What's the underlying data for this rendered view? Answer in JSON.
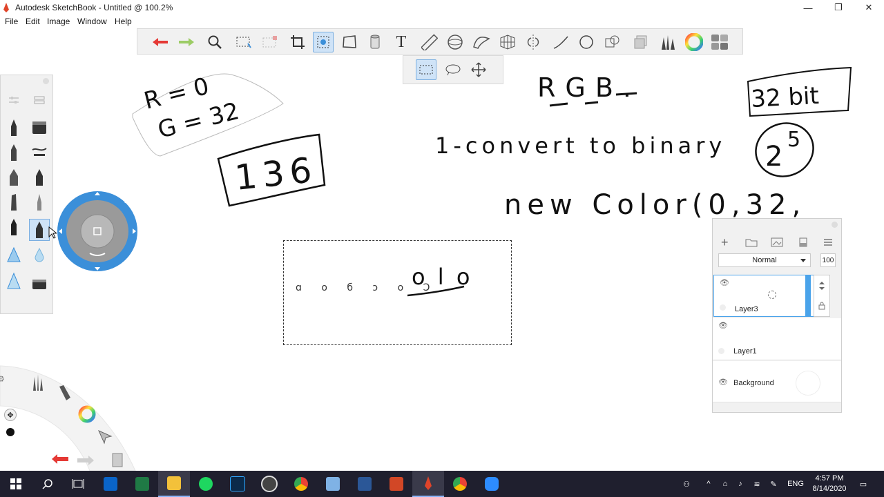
{
  "window": {
    "title": "Autodesk SketchBook - Untitled @ 100.2%",
    "minimize_glyph": "—",
    "maximize_glyph": "❐",
    "close_glyph": "✕"
  },
  "menu": [
    "File",
    "Edit",
    "Image",
    "Window",
    "Help"
  ],
  "toolbar": {
    "tools": [
      "undo-icon",
      "redo-icon",
      "zoom-icon",
      "select-rect-icon",
      "select-lasso-icon",
      "crop-icon",
      "transform-icon",
      "distort-icon",
      "fill-icon",
      "text-icon",
      "ruler-icon",
      "ellipse-guide-icon",
      "french-curve-icon",
      "perspective-icon",
      "symmetry-icon",
      "stroke-icon",
      "shape-icon",
      "copy-paste-icon",
      "layers-icon",
      "brushes-icon",
      "color-wheel-icon",
      "palette-icon"
    ],
    "active_tool": "transform-icon",
    "text_tool_glyph": "T"
  },
  "subtools": [
    "rectangle-select-icon",
    "lasso-select-icon",
    "move-icon"
  ],
  "canvas_text": {
    "r_eq": "R = 0",
    "g_eq": "G = 32",
    "boxed_136": "136",
    "rgb": "RGB.",
    "step1": "1-convert to binary",
    "newcolor": "new Color(0,32,",
    "bit32": "32 bit",
    "two": "2",
    "five": "5",
    "binary_small": "ɑ o  б  ͻ o Ͻ",
    "binary_big": "o l o"
  },
  "layers": {
    "blend_mode": "Normal",
    "opacity": "100",
    "items": [
      {
        "name": "Layer3",
        "selected": true
      },
      {
        "name": "Layer1",
        "selected": false
      },
      {
        "name": "Background",
        "selected": false
      }
    ]
  },
  "taskbar": {
    "apps": [
      "start",
      "search",
      "task-view",
      "mail",
      "excel",
      "file-explorer",
      "spotify",
      "photoshop",
      "media",
      "chrome",
      "virtualbox",
      "word",
      "powerpoint",
      "sketchbook",
      "chrome-2",
      "zoom"
    ],
    "time": "4:57 PM",
    "date": "8/14/2020",
    "lang": "ENG"
  },
  "colors": {
    "accent_blue": "#3b8fd9",
    "undo_red": "#e53935",
    "redo_green": "#9ccc65",
    "taskbar": "#1f1f2e"
  }
}
